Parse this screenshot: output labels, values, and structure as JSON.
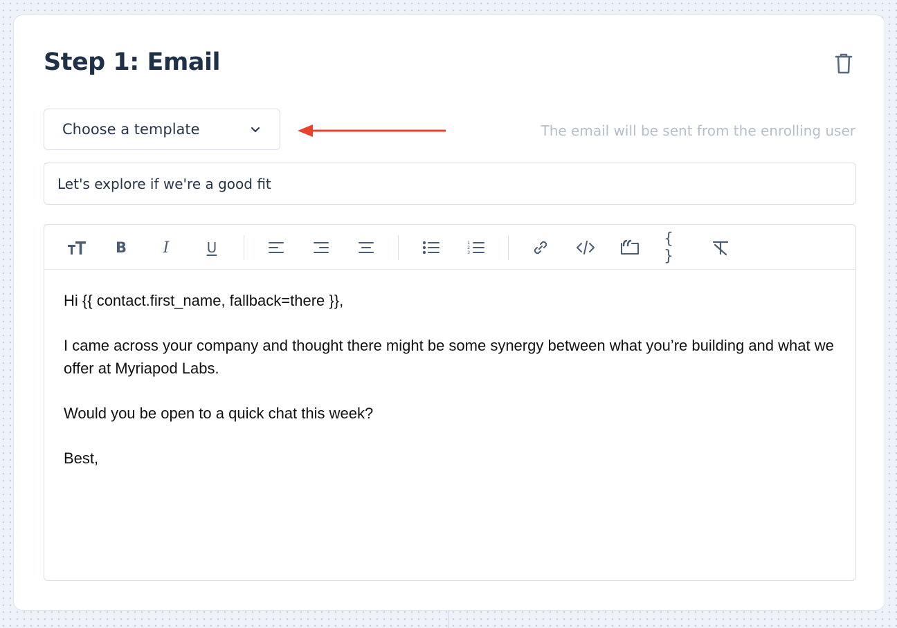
{
  "step": {
    "title": "Step 1: Email"
  },
  "template_select": {
    "label": "Choose a template"
  },
  "sender_note": "The email will be sent from the enrolling user",
  "subject": {
    "value": "Let's explore if we're a good fit"
  },
  "toolbar": {
    "items": [
      "text-size-icon",
      "bold-icon",
      "italic-icon",
      "underline-icon",
      "align-left-icon",
      "align-right-icon",
      "align-center-icon",
      "bullet-list-icon",
      "numbered-list-icon",
      "link-icon",
      "code-icon",
      "quote-icon",
      "variable-braces-icon",
      "clear-format-icon"
    ],
    "bold_glyph": "B",
    "italic_glyph": "I",
    "underline_glyph": "U",
    "braces_glyph": "{ }"
  },
  "body": {
    "paragraphs": [
      "Hi {{ contact.first_name, fallback=there }},",
      "I came across your company and thought there might be some synergy between what you’re building and what we offer at Myriapod Labs.",
      "Would you be open to a quick chat this week?",
      "Best,"
    ]
  },
  "colors": {
    "annotation_arrow": "#e8412c",
    "title": "#1f3147",
    "icon": "#4a5c72",
    "muted_text": "#b4bfcc"
  }
}
